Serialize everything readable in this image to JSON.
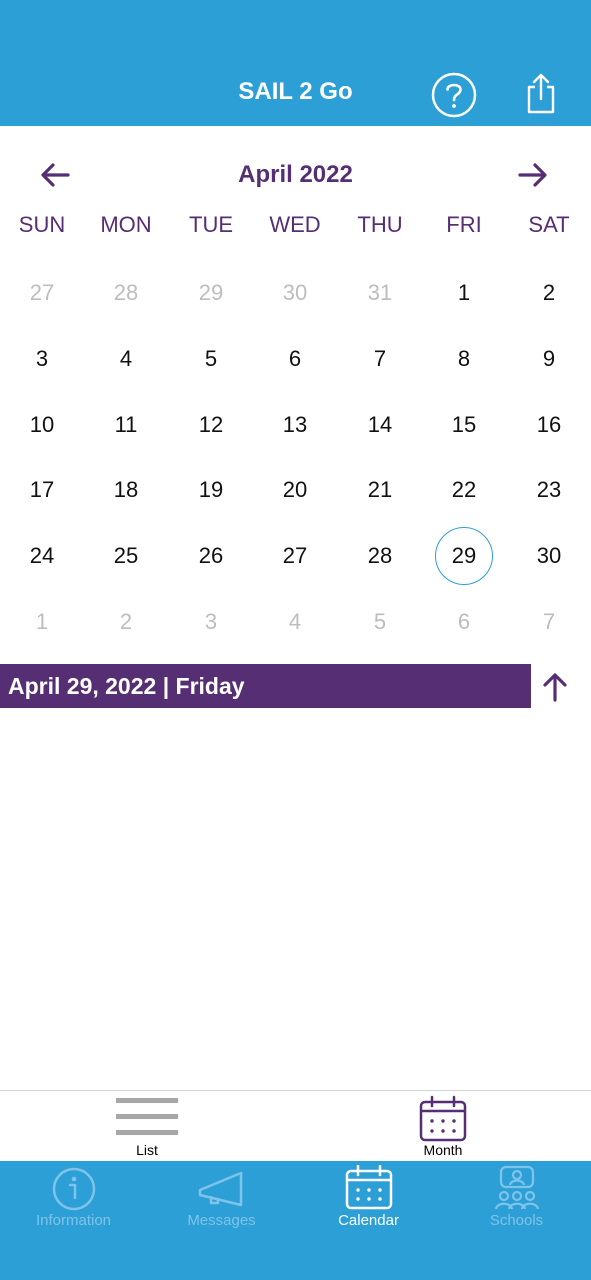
{
  "header": {
    "title": "SAIL 2 Go",
    "help_icon": "question-circle-icon",
    "share_icon": "share-icon"
  },
  "calendar": {
    "month_label": "April 2022",
    "prev_icon": "arrow-left-icon",
    "next_icon": "arrow-right-icon",
    "weekdays": [
      "SUN",
      "MON",
      "TUE",
      "WED",
      "THU",
      "FRI",
      "SAT"
    ],
    "weeks": [
      [
        "27",
        "28",
        "29",
        "30",
        "31",
        "1",
        "2"
      ],
      [
        "3",
        "4",
        "5",
        "6",
        "7",
        "8",
        "9"
      ],
      [
        "10",
        "11",
        "12",
        "13",
        "14",
        "15",
        "16"
      ],
      [
        "17",
        "18",
        "19",
        "20",
        "21",
        "22",
        "23"
      ],
      [
        "24",
        "25",
        "26",
        "27",
        "28",
        "29",
        "30"
      ],
      [
        "1",
        "2",
        "3",
        "4",
        "5",
        "6",
        "7"
      ]
    ],
    "selected_day": "29"
  },
  "selected_date": {
    "label": "April 29, 2022 | Friday",
    "collapse_icon": "arrow-up-icon"
  },
  "view_toggle": [
    {
      "label": "List",
      "icon": "list-icon",
      "active": false
    },
    {
      "label": "Month",
      "icon": "calendar-icon",
      "active": true
    }
  ],
  "tabs": [
    {
      "label": "Information",
      "icon": "info-circle-icon",
      "active": false
    },
    {
      "label": "Messages",
      "icon": "megaphone-icon",
      "active": false
    },
    {
      "label": "Calendar",
      "icon": "calendar-icon",
      "active": true
    },
    {
      "label": "Schools",
      "icon": "group-icon",
      "active": false
    }
  ],
  "colors": {
    "primary_blue": "#2c9fd7",
    "accent_purple": "#562e74",
    "muted_day": "#bdbdbd",
    "inactive_tab": "#7fc3e8"
  }
}
